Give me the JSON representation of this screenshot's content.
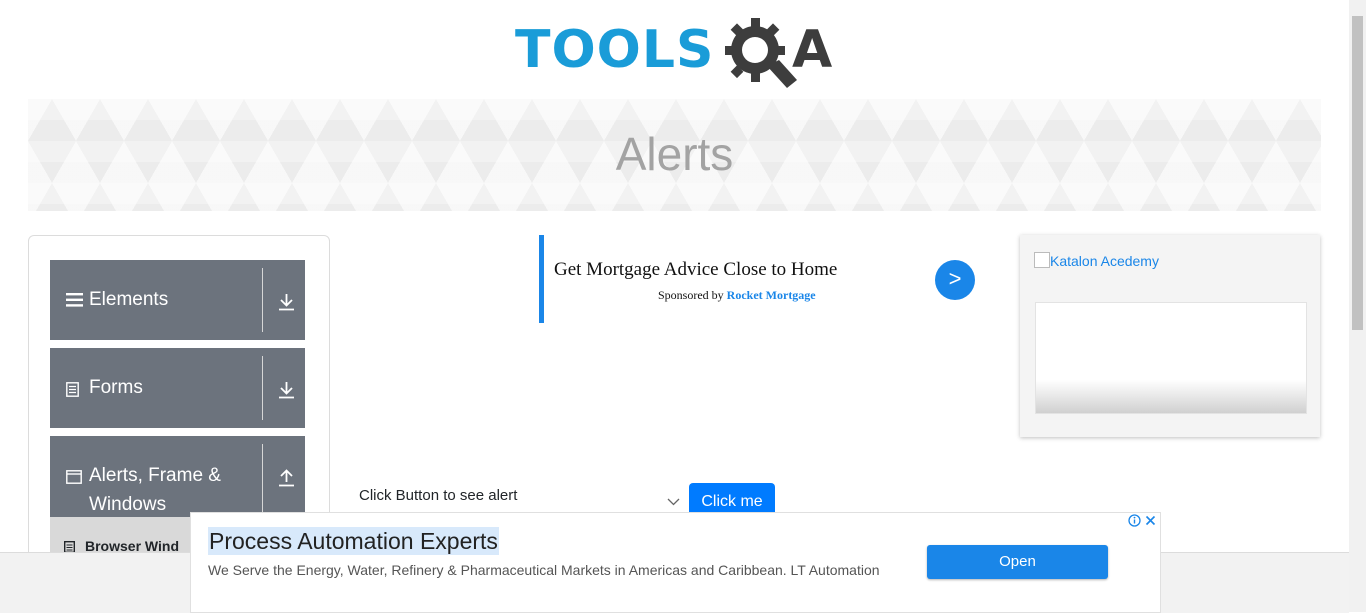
{
  "header": {
    "logo_text_left": "TOOLS",
    "logo_text_right": "A",
    "logo_alt": "TOOLSQA"
  },
  "banner": {
    "title": "Alerts"
  },
  "sidebar": {
    "groups": [
      {
        "label": "Elements",
        "icon": "hamburger-icon",
        "arrow": "download-arrow-icon"
      },
      {
        "label": "Forms",
        "icon": "document-icon",
        "arrow": "download-arrow-icon"
      },
      {
        "label_line1": "Alerts, Frame &",
        "label_line2": "Windows",
        "icon": "window-icon",
        "arrow": "upload-arrow-icon"
      }
    ],
    "active_item": {
      "label": "Browser Wind",
      "icon": "page-icon"
    }
  },
  "ad_center": {
    "headline": "Get Mortgage Advice Close to Home",
    "sponsored_by": "Sponsored by",
    "sponsor": "Rocket Mortgage",
    "go": ">"
  },
  "ad_right": {
    "alt_text": "Katalon Acedemy"
  },
  "alert_section": {
    "label": "Click Button to see alert",
    "button": "Click me"
  },
  "ad_bottom": {
    "title": "Process Automation Experts",
    "description": "We Serve the Energy, Water, Refinery & Pharmaceutical Markets in Americas and Caribbean. LT Automation",
    "open": "Open"
  },
  "colors": {
    "brand_blue": "#1a9cd8",
    "nav_gray": "#6c737d",
    "button_blue": "#007bff",
    "ad_blue": "#1a86e8"
  }
}
